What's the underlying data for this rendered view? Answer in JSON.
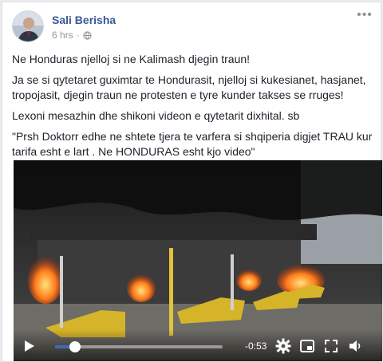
{
  "post": {
    "author": "Sali Berisha",
    "time": "6 hrs",
    "separator": "·",
    "privacy_icon": "globe-icon",
    "more_icon": "more-options-icon",
    "more_glyph": "•••"
  },
  "body": {
    "p1": "Ne Honduras njelloj si ne Kalimash djegin traun!",
    "p2": "Ja se si qytetaret guximtar te Hondurasit, njelloj si kukesianet, hasjanet, tropojasit, djegin traun ne protesten e tyre kunder takses se rruges!",
    "p3": "Lexoni mesazhin dhe shikoni videon e qytetarit dixhital. sb",
    "p4": "\"Prsh Doktorr edhe ne shtete tjera te varfera si shqiperia digjet TRAU kur tarifa esht e lart . Ne HONDURAS esht kjo video\""
  },
  "video": {
    "remaining_time": "-0:53",
    "progress": 0.12,
    "icons": [
      "play-icon",
      "settings-gear-icon",
      "picture-in-picture-icon",
      "fullscreen-icon",
      "volume-icon"
    ]
  },
  "colors": {
    "link": "#365899",
    "secondary": "#90949c",
    "accent": "#4267b2"
  }
}
